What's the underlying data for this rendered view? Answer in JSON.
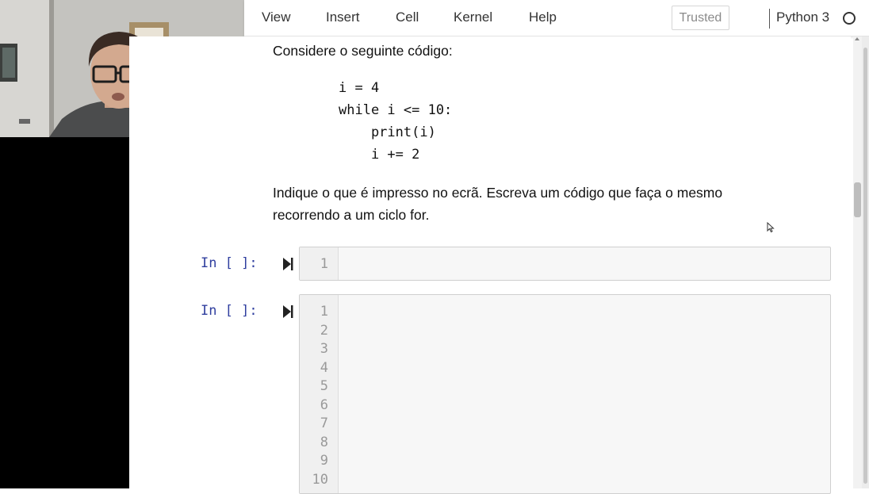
{
  "menubar": {
    "items": [
      "View",
      "Insert",
      "Cell",
      "Kernel",
      "Help"
    ],
    "trusted_label": "Trusted",
    "kernel_name": "Python 3"
  },
  "notebook": {
    "intro_text": "Considere o seguinte código:",
    "code_listing": "i = 4\nwhile i <= 10:\n    print(i)\n    i += 2",
    "question_line1": "Indique o que é impresso no ecrã. Escreva um código que faça o mesmo",
    "question_line2": "recorrendo a um ciclo for.",
    "cells": [
      {
        "prompt": "In [ ]:",
        "line_numbers": [
          "1"
        ]
      },
      {
        "prompt": "In [ ]:",
        "line_numbers": [
          "1",
          "2",
          "3",
          "4",
          "5",
          "6",
          "7",
          "8",
          "9",
          "10"
        ]
      }
    ]
  },
  "colors": {
    "prompt": "#303f9f",
    "cell_background": "#f7f7f7",
    "cell_border": "#cfcfcf"
  }
}
